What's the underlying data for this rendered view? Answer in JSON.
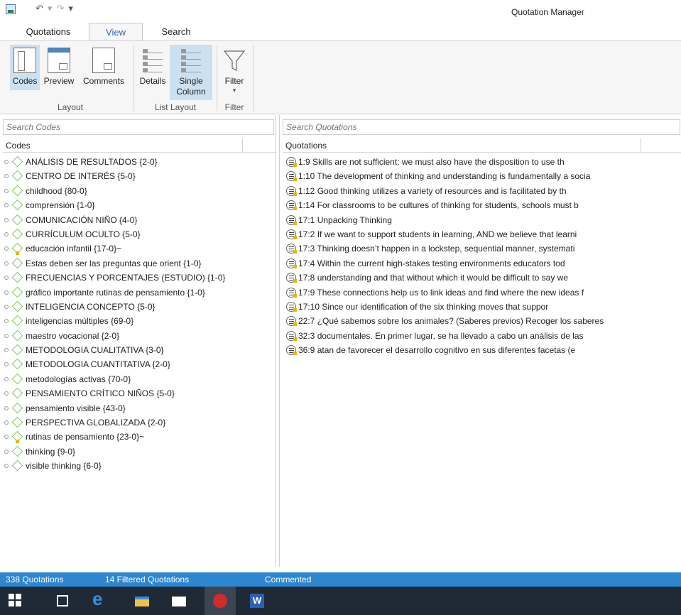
{
  "window": {
    "title": "Quotation Manager",
    "qat": {
      "undo": "↶",
      "undo_dropdown": "▾",
      "redo": "↷",
      "customize": "▾"
    }
  },
  "tabs": [
    {
      "label": "Quotations"
    },
    {
      "label": "View",
      "active": true
    },
    {
      "label": "Search"
    }
  ],
  "ribbon": {
    "layout": {
      "label": "Layout",
      "buttons": [
        {
          "label": "Codes",
          "icon": "codes-pane-icon",
          "selected": true
        },
        {
          "label": "Preview",
          "icon": "preview-pane-icon"
        },
        {
          "label": "Comments",
          "icon": "comments-pane-icon"
        }
      ]
    },
    "list_layout": {
      "label": "List Layout",
      "buttons": [
        {
          "label": "Details",
          "icon": "details-list-icon"
        },
        {
          "label_line1": "Single",
          "label_line2": "Column",
          "icon": "single-column-icon",
          "selected": true
        }
      ]
    },
    "filter": {
      "label": "Filter",
      "button": {
        "label": "Filter",
        "icon": "funnel-icon",
        "arrow": "▾"
      }
    }
  },
  "codes_pane": {
    "search_placeholder": "Search Codes",
    "header": "Codes",
    "items": [
      {
        "label": "ANÁLISIS DE RESULTADOS {2-0}"
      },
      {
        "label": "CENTRO DE INTERÉS {5-0}"
      },
      {
        "label": "childhood {80-0}"
      },
      {
        "label": "comprensión {1-0}"
      },
      {
        "label": "COMUNICACIÓN NIÑO {4-0}"
      },
      {
        "label": "CURRÍCULUM OCULTO {5-0}"
      },
      {
        "label": "educación infantil {17-0}~",
        "commented": true
      },
      {
        "label": "Estas deben ser las preguntas que orient {1-0}"
      },
      {
        "label": "FRECUENCIAS Y PORCENTAJES (ESTUDIO) {1-0}"
      },
      {
        "label": "gráfico importante rutinas de pensamiento {1-0}"
      },
      {
        "label": "INTELIGENCIA CONCEPTO {5-0}"
      },
      {
        "label": "inteligencias múltiples {69-0}"
      },
      {
        "label": "maestro vocacional {2-0}"
      },
      {
        "label": "METODOLOGIA CUALITATIVA {3-0}"
      },
      {
        "label": "METODOLOGIA CUANTITATIVA {2-0}"
      },
      {
        "label": "metodologías activas {70-0}"
      },
      {
        "label": "PENSAMIENTO CRÍTICO NIÑOS {5-0}"
      },
      {
        "label": "pensamiento visible {43-0}"
      },
      {
        "label": "PERSPECTIVA GLOBALIZADA {2-0}"
      },
      {
        "label": "rutinas de pensamiento {23-0}~",
        "commented": true
      },
      {
        "label": "thinking {9-0}"
      },
      {
        "label": "visible thinking {6-0}"
      }
    ]
  },
  "quotations_pane": {
    "search_placeholder": "Search Quotations",
    "header": "Quotations",
    "items": [
      {
        "text": "1:9 Skills are not sufficient; we must also have the disposition to use th"
      },
      {
        "text": "1:10 The development of thinking and understanding is fundamentally a socia"
      },
      {
        "text": "1:12 Good thinking utilizes a variety of resources and is facilitated by th"
      },
      {
        "text": "1:14 For classrooms to be cultures of thinking for students, schools must b"
      },
      {
        "text": "17:1 Unpacking Thinking"
      },
      {
        "text": "17:2 If we want to support students in learning, AND we believe that learni"
      },
      {
        "text": "17:3 Thinking doesn’t happen in a lockstep,  sequential  manner,  systemati"
      },
      {
        "text": "17:4 Within  the  current  high-stakes  testing  environments educators tod"
      },
      {
        "text": "17:8 understanding and that without which it would be difficult to say  we"
      },
      {
        "text": "17:9 These connections help us to link ideas and find where the new ideas f"
      },
      {
        "text": "17:10 Since  our  identification  of  the  six  thinking  moves  that  suppor"
      },
      {
        "text": "22:7 ¿Qué sabemos sobre los animales? (Saberes previos) Recoger los saberes"
      },
      {
        "text": "32:3 documentales. En primer lugar, se ha llevado a cabo un análisis de las"
      },
      {
        "text": "36:9 atan de favorecer el desarrollo cognitivo en sus diferentes facetas (e"
      }
    ]
  },
  "status": {
    "total": "338 Quotations",
    "filtered": "14 Filtered Quotations",
    "commented": "Commented"
  },
  "taskbar": {
    "apps": [
      "windows-start-icon",
      "task-view-icon",
      "edge-browser-icon",
      "file-explorer-icon",
      "mail-icon",
      "atlas-ti-icon",
      "word-icon"
    ],
    "word_letter": "W"
  }
}
